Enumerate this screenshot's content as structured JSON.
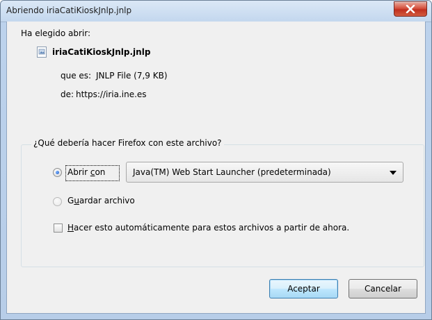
{
  "window": {
    "title": "Abriendo iriaCatiKioskJnlp.jnlp",
    "close_label": "close"
  },
  "dialog": {
    "intro": "Ha elegido abrir:",
    "file_name": "iriaCatiKioskJnlp.jnlp",
    "type_label": "que es:",
    "type_value": "JNLP File (7,9 KB)",
    "from_label": "de:",
    "from_value": "https://iria.ine.es",
    "question": "¿Qué debería hacer Firefox con este archivo?",
    "open_with": {
      "pre": "Abrir ",
      "accel": "c",
      "post": "on",
      "selected": true
    },
    "app_select": {
      "value": "Java(TM) Web Start Launcher (predeterminada)"
    },
    "save_file": {
      "pre": "G",
      "accel": "u",
      "post": "ardar archivo",
      "selected": false
    },
    "auto_check": {
      "pre": "",
      "accel": "H",
      "post": "acer esto automáticamente para estos archivos a partir de ahora.",
      "checked": false
    },
    "accept_label": "Aceptar",
    "cancel_label": "Cancelar"
  },
  "colors": {
    "title_bg": "#c3d7ee",
    "close_red": "#c0301f",
    "client_bg": "#f0f0f0",
    "default_button": "#bee6fd"
  }
}
